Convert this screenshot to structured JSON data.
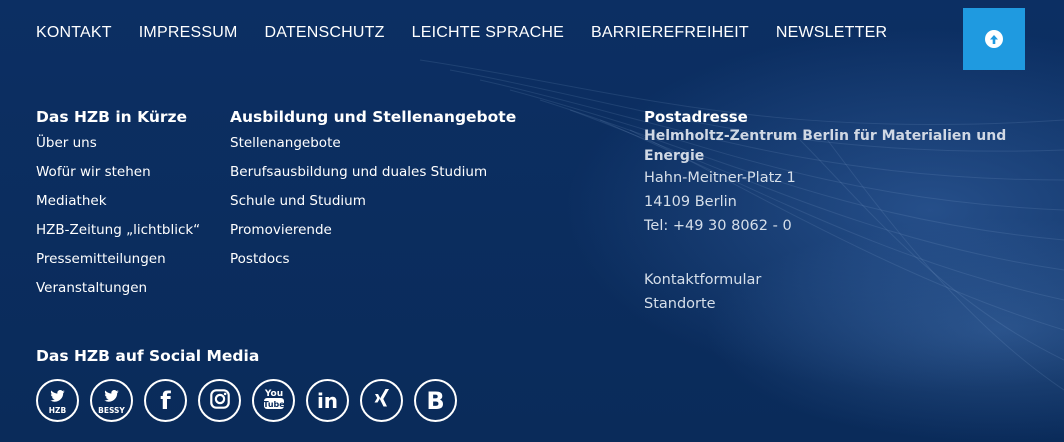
{
  "topnav": {
    "items": [
      "KONTAKT",
      "IMPRESSUM",
      "DATENSCHUTZ",
      "LEICHTE SPRACHE",
      "BARRIEREFREIHEIT",
      "NEWSLETTER"
    ]
  },
  "scroll_top_button": {
    "icon": "arrow-up-circle-icon",
    "color": "#1f9ae0"
  },
  "about": {
    "heading": "Das HZB in Kürze",
    "links": [
      "Über uns",
      "Wofür wir stehen",
      "Mediathek",
      "HZB-Zeitung „lichtblick“",
      "Pressemitteilungen",
      "Veranstaltungen"
    ]
  },
  "careers": {
    "heading": "Ausbildung und Stellenangebote",
    "links": [
      "Stellenangebote",
      "Berufsausbildung und duales Studium",
      "Schule und Studium",
      "Promovierende",
      "Postdocs"
    ]
  },
  "address": {
    "heading": "Postadresse",
    "organization": "Helmholtz-Zentrum Berlin für Materialien und Energie",
    "street": "Hahn-Meitner-Platz 1",
    "city": "14109 Berlin",
    "phone": "Tel: +49 30 8062 - 0",
    "links": [
      "Kontaktformular",
      "Standorte"
    ]
  },
  "social": {
    "heading": "Das HZB auf Social Media",
    "icons": [
      {
        "name": "twitter-icon",
        "label": "HZB"
      },
      {
        "name": "twitter-icon",
        "label": "BESSY"
      },
      {
        "name": "facebook-icon",
        "glyph": "f"
      },
      {
        "name": "instagram-icon"
      },
      {
        "name": "youtube-icon"
      },
      {
        "name": "linkedin-icon",
        "glyph": "in"
      },
      {
        "name": "xing-icon"
      },
      {
        "name": "b-icon",
        "glyph": "B"
      }
    ]
  },
  "colors": {
    "background": "#0b2d5e",
    "accent": "#1f9ae0",
    "text": "#ffffff"
  }
}
